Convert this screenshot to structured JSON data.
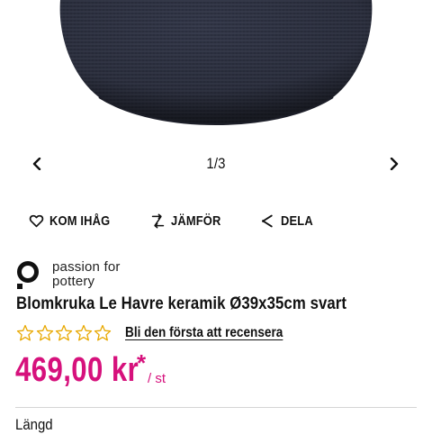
{
  "gallery": {
    "counter": "1/3",
    "prev_icon": "chevron-left-icon",
    "next_icon": "chevron-right-icon"
  },
  "actions": [
    {
      "label": "KOM IHÅG",
      "icon": "heart-icon"
    },
    {
      "label": "JÄMFÖR",
      "icon": "compare-arrows-icon"
    },
    {
      "label": "DELA",
      "icon": "share-icon"
    }
  ],
  "brand": {
    "line1": "passion for",
    "line2": "pottery"
  },
  "product": {
    "title": "Blomkruka Le Havre keramik Ø39x35cm svart"
  },
  "rating": {
    "stars_filled": 0,
    "stars_total": 5,
    "review_link": "Bli den första att recensera"
  },
  "price": {
    "value": "469,00 kr",
    "asterisk": "*",
    "unit": "/ st"
  },
  "section": {
    "label": "Längd"
  },
  "colors": {
    "price": "#d6117c",
    "star_outline": "#e8a800",
    "pot": "#2a2d3a"
  }
}
